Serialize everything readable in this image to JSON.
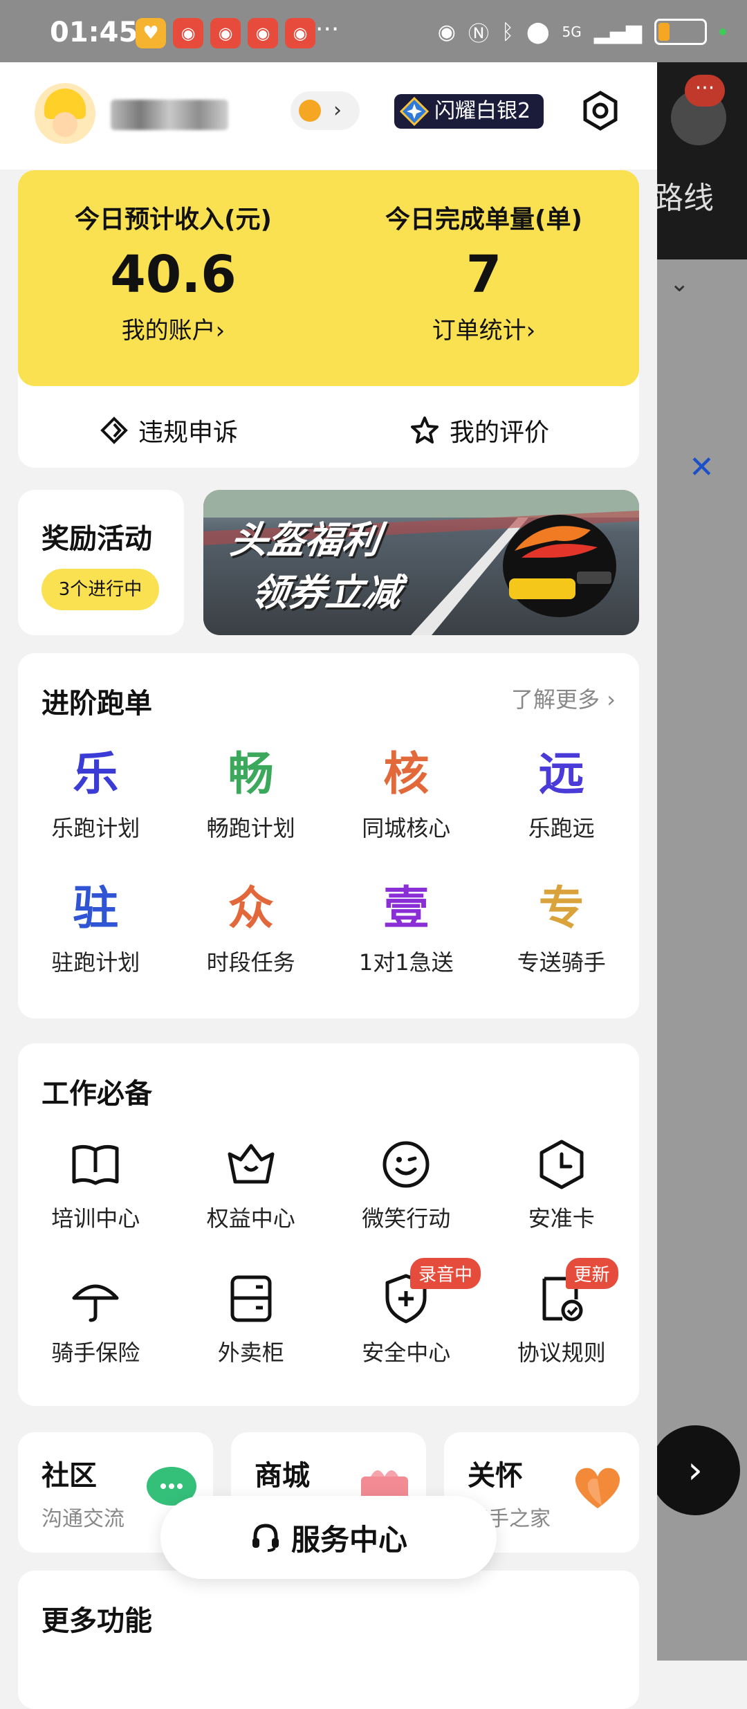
{
  "status_bar": {
    "time": "01:45",
    "more": "···",
    "network": "5G"
  },
  "header": {
    "rank_label": "闪耀白银2"
  },
  "income_card": {
    "income_label": "今日预计收入(元)",
    "income_value": "40.6",
    "account_link": "我的账户›",
    "orders_label": "今日完成单量(单)",
    "orders_value": "7",
    "orders_link": "订单统计›",
    "appeal_label": "违规申诉",
    "rating_label": "我的评价"
  },
  "reward": {
    "title": "奖励活动",
    "pill": "3个进行中"
  },
  "banner": {
    "line1": "头盔福利",
    "line2": "领券立减"
  },
  "advanced": {
    "title": "进阶跑单",
    "more": "了解更多 ›",
    "items": [
      {
        "glyph": "乐",
        "label": "乐跑计划",
        "color": "#3b3bd6"
      },
      {
        "glyph": "畅",
        "label": "畅跑计划",
        "color": "#3ca85c"
      },
      {
        "glyph": "核",
        "label": "同城核心",
        "color": "#e2693a"
      },
      {
        "glyph": "远",
        "label": "乐跑远",
        "color": "#4a3ad8"
      },
      {
        "glyph": "驻",
        "label": "驻跑计划",
        "color": "#2f55d4"
      },
      {
        "glyph": "众",
        "label": "时段任务",
        "color": "#e2673a"
      },
      {
        "glyph": "壹",
        "label": "1对1急送",
        "color": "#8a2fd6"
      },
      {
        "glyph": "专",
        "label": "专送骑手",
        "color": "#d9a23a"
      }
    ]
  },
  "work": {
    "title": "工作必备",
    "items": [
      {
        "icon": "book-icon",
        "label": "培训中心"
      },
      {
        "icon": "crown-icon",
        "label": "权益中心"
      },
      {
        "icon": "smile-icon",
        "label": "微笑行动"
      },
      {
        "icon": "clock-icon",
        "label": "安准卡"
      },
      {
        "icon": "umbrella-icon",
        "label": "骑手保险"
      },
      {
        "icon": "cabinet-icon",
        "label": "外卖柜"
      },
      {
        "icon": "shield-icon",
        "label": "安全中心",
        "tag": "录音中"
      },
      {
        "icon": "document-icon",
        "label": "协议规则",
        "tag": "更新"
      }
    ]
  },
  "mini_cards": [
    {
      "title": "社区",
      "sub": "沟通交流"
    },
    {
      "title": "商城",
      "sub": ""
    },
    {
      "title": "关怀",
      "sub": "骑手之家"
    }
  ],
  "service_button": "服务中心",
  "more_features": {
    "title": "更多功能"
  },
  "peek": {
    "route": "路线"
  }
}
